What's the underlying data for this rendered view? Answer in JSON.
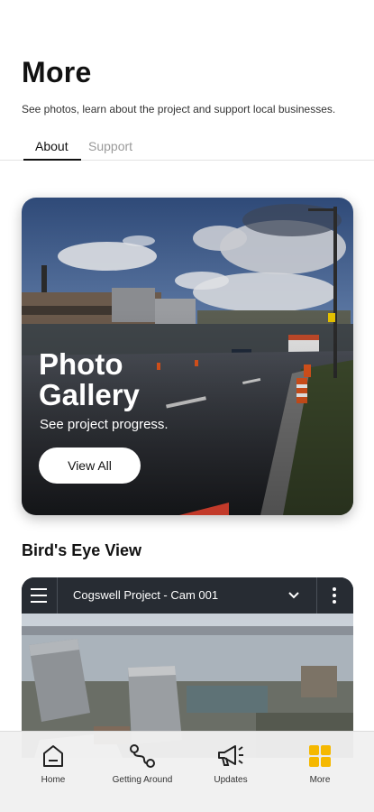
{
  "header": {
    "title": "More",
    "subtitle": "See photos, learn about the project and support local businesses."
  },
  "tabs": [
    {
      "label": "About",
      "active": true
    },
    {
      "label": "Support",
      "active": false
    }
  ],
  "gallery": {
    "title": "Photo Gallery",
    "subtitle": "See project progress.",
    "button_label": "View All"
  },
  "birds_eye": {
    "section_title": "Bird's Eye View",
    "camera_title": "Cogswell Project - Cam 001",
    "icons": [
      "menu-icon",
      "chevron-down-icon",
      "kebab-menu-icon"
    ]
  },
  "bottom_nav": {
    "items": [
      {
        "label": "Home",
        "icon": "home-icon",
        "active": false
      },
      {
        "label": "Getting Around",
        "icon": "route-icon",
        "active": false
      },
      {
        "label": "Updates",
        "icon": "megaphone-icon",
        "active": false
      },
      {
        "label": "More",
        "icon": "grid-icon",
        "active": true
      }
    ],
    "active_color": "#f5b800"
  }
}
